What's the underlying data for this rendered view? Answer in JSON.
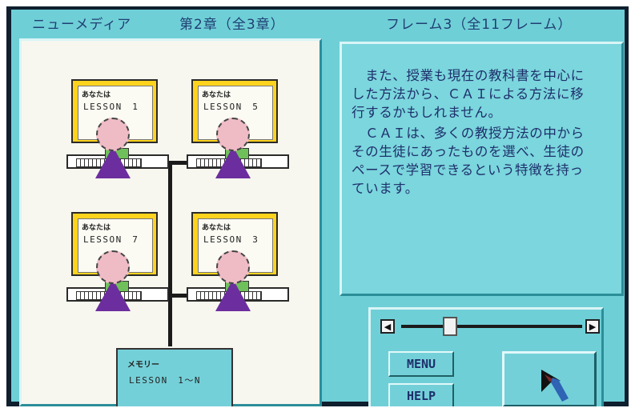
{
  "header": {
    "app_title": "ニューメディア",
    "chapter": "第2章（全3章）",
    "frame": "フレーム3（全11フレーム）"
  },
  "diagram": {
    "stations": [
      {
        "you_label": "あなたは",
        "lesson": "LESSON　1"
      },
      {
        "you_label": "あなたは",
        "lesson": "LESSON　5"
      },
      {
        "you_label": "あなたは",
        "lesson": "LESSON　7"
      },
      {
        "you_label": "あなたは",
        "lesson": "LESSON　3"
      }
    ],
    "memory": {
      "title": "メモリー",
      "lesson": "LESSON　1～N"
    },
    "colors": {
      "monitor": "#ffd31d",
      "body": "#6c2e9e",
      "head": "#efbcc6",
      "chair": "#6fc05a"
    }
  },
  "text_panel": {
    "lines": [
      "　また、授業も現在の教科書を中心に",
      "した方法から、ＣＡＩによる方法に移",
      "行するかもしれません。",
      "　ＣＡＩは、多くの教授方法の中から",
      "その生徒にあったものを選べ、生徒の",
      "ペースで学習できるという特徴を持っ",
      "ています。"
    ]
  },
  "controls": {
    "scroll_left_icon": "◀",
    "scroll_right_icon": "▶",
    "scroll_position": 0.25,
    "menu_label": "MENU",
    "help_label": "HELP",
    "next_icon": "cursor-arrow-icon"
  }
}
